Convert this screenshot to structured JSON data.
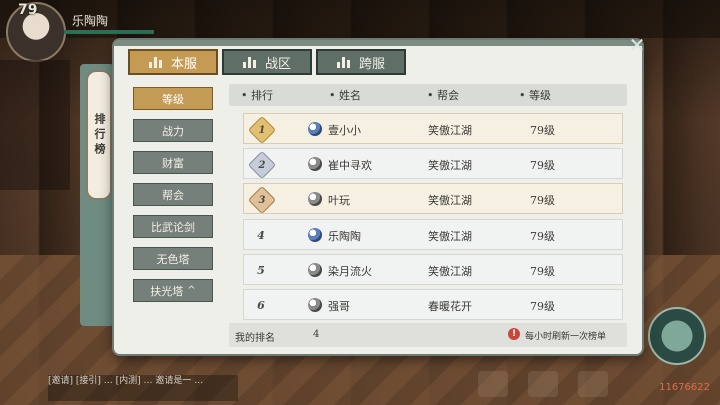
{
  "hud": {
    "level": "79",
    "player_name": "乐陶陶",
    "chat_text": "[邀请]   [接引]  … [内测] … 邀请是一 …",
    "power_value": "11676622"
  },
  "tabs": [
    {
      "label": "本服",
      "active": true
    },
    {
      "label": "战区",
      "active": false
    },
    {
      "label": "跨服",
      "active": false
    }
  ],
  "ribbon_title": "排行榜",
  "categories": [
    {
      "label": "等级",
      "active": true
    },
    {
      "label": "战力"
    },
    {
      "label": "财富"
    },
    {
      "label": "帮会"
    },
    {
      "label": "比武论剑"
    },
    {
      "label": "无色塔"
    },
    {
      "label": "扶光塔",
      "caret": "^"
    }
  ],
  "table": {
    "headers": {
      "rank": "排行",
      "name": "姓名",
      "guild": "帮会",
      "level": "等级"
    },
    "rows": [
      {
        "rank": "1",
        "name": "壹小小",
        "guild": "笑傲江湖",
        "level": "79级"
      },
      {
        "rank": "2",
        "name": "崔中寻欢",
        "guild": "笑傲江湖",
        "level": "79级"
      },
      {
        "rank": "3",
        "name": "叶玩",
        "guild": "笑傲江湖",
        "level": "79级"
      },
      {
        "rank": "4",
        "name": "乐陶陶",
        "guild": "笑傲江湖",
        "level": "79级"
      },
      {
        "rank": "5",
        "name": "染月流火",
        "guild": "笑傲江湖",
        "level": "79级"
      },
      {
        "rank": "6",
        "name": "强哥",
        "guild": "春暖花开",
        "level": "79级"
      }
    ]
  },
  "footer": {
    "my_rank_label": "我的排名",
    "my_rank_value": "4",
    "refresh_note": "每小时刷新一次榜单"
  },
  "close_symbol": "✕"
}
